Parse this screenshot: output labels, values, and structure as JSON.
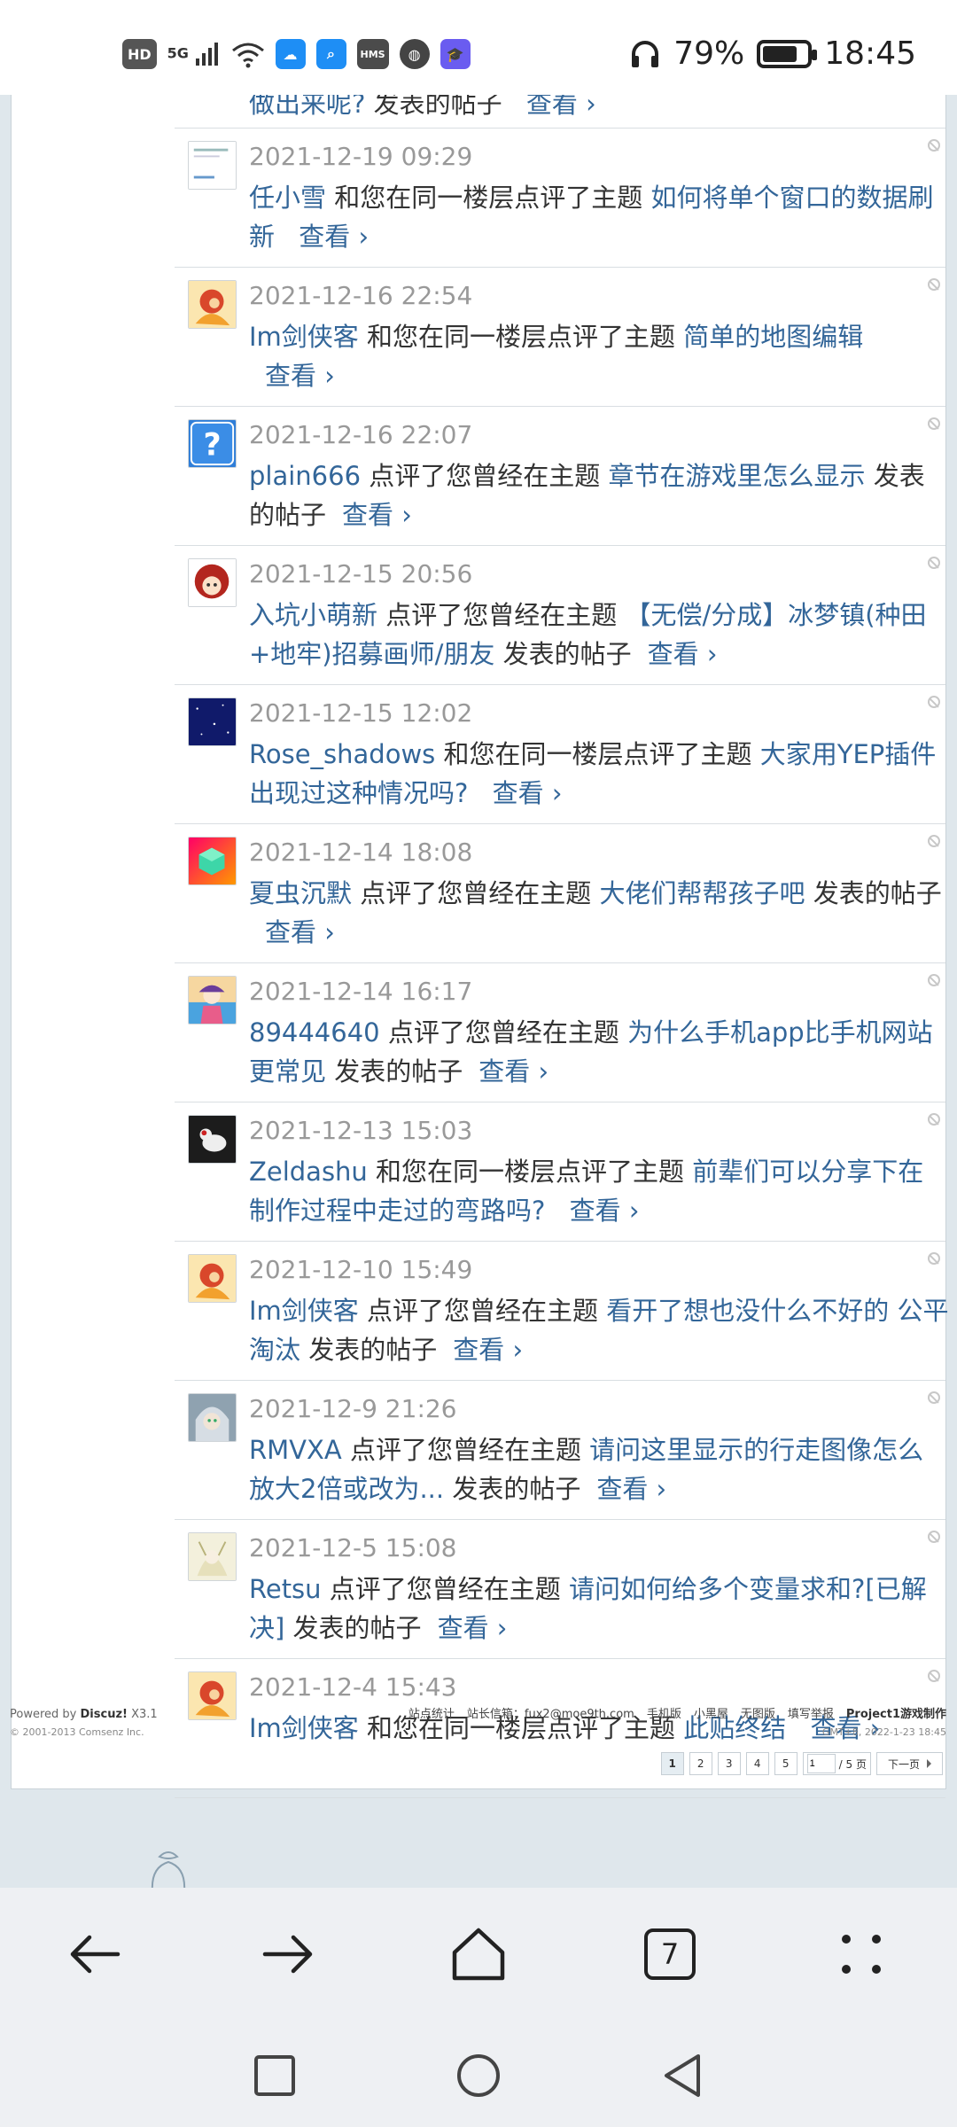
{
  "status_bar": {
    "hd": "HD",
    "net": "5G",
    "hms": "HMS",
    "battery_pct": "79%",
    "battery_level": 0.79,
    "time": "18:45"
  },
  "partial_top": {
    "text_link": "做出来呢?",
    "text_tail": "发表的帖子",
    "more": "查看 ›"
  },
  "notices": [
    {
      "date": "2021-12-19 09:29",
      "user": "任小雪",
      "action": "和您在同一楼层点评了主题",
      "topic": "如何将单个窗口的数据刷新",
      "tail": "",
      "more": "查看 ›",
      "avatar": "doc"
    },
    {
      "date": "2021-12-16 22:54",
      "user": "Im剑侠客",
      "action": "和您在同一楼层点评了主题",
      "topic": "简单的地图编辑",
      "tail": "",
      "more": "查看 ›",
      "avatar": "warrior"
    },
    {
      "date": "2021-12-16 22:07",
      "user": "plain666",
      "action": "点评了您曾经在主题",
      "topic": "章节在游戏里怎么显示",
      "tail": "发表的帖子",
      "more": "查看 ›",
      "avatar": "question"
    },
    {
      "date": "2021-12-15 20:56",
      "user": "入坑小萌新",
      "action": "点评了您曾经在主题",
      "topic": "【无偿/分成】冰梦镇(种田+地牢)招募画师/朋友",
      "tail": "发表的帖子",
      "more": "查看 ›",
      "avatar": "redgirl"
    },
    {
      "date": "2021-12-15 12:02",
      "user": "Rose_shadows",
      "action": "和您在同一楼层点评了主题",
      "topic": "大家用YEP插件出现过这种情况吗?",
      "tail": "",
      "more": "查看 ›",
      "avatar": "stars"
    },
    {
      "date": "2021-12-14 18:08",
      "user": "夏虫沉默",
      "action": "点评了您曾经在主题",
      "topic": "大佬们帮帮孩子吧",
      "tail": "发表的帖子",
      "more": "查看 ›",
      "avatar": "cube"
    },
    {
      "date": "2021-12-14 16:17",
      "user": "89444640",
      "action": "点评了您曾经在主题",
      "topic": "为什么手机app比手机网站更常见",
      "tail": "发表的帖子",
      "more": "查看 ›",
      "avatar": "anime"
    },
    {
      "date": "2021-12-13 15:03",
      "user": "Zeldashu",
      "action": "和您在同一楼层点评了主题",
      "topic": "前辈们可以分享下在制作过程中走过的弯路吗?",
      "tail": "",
      "more": "查看 ›",
      "avatar": "bird"
    },
    {
      "date": "2021-12-10 15:49",
      "user": "Im剑侠客",
      "action": "点评了您曾经在主题",
      "topic": "看开了想也没什么不好的 公平淘汰",
      "tail": "发表的帖子",
      "more": "查看 ›",
      "avatar": "warrior"
    },
    {
      "date": "2021-12-9 21:26",
      "user": "RMVXA",
      "action": "点评了您曾经在主题",
      "topic": "请问这里显示的行走图像怎么放大2倍或改为...",
      "tail": "发表的帖子",
      "more": "查看 ›",
      "avatar": "silver"
    },
    {
      "date": "2021-12-5 15:08",
      "user": "Retsu",
      "action": "点评了您曾经在主题",
      "topic": "请问如何给多个变量求和?[已解决]",
      "tail": "发表的帖子",
      "more": "查看 ›",
      "avatar": "elf"
    },
    {
      "date": "2021-12-4 15:43",
      "user": "Im剑侠客",
      "action": "和您在同一楼层点评了主题",
      "topic": "此贴终结",
      "tail": "",
      "more": "查看 ›",
      "avatar": "warrior"
    }
  ],
  "pager": {
    "pages": [
      "1",
      "2",
      "3",
      "4",
      "5"
    ],
    "input_value": "1",
    "total": "/ 5 页",
    "next": "下一页"
  },
  "footer": {
    "powered": "Powered by",
    "brand": "Discuz!",
    "version": "X3.1",
    "copyright": "© 2001-2013 Comsenz Inc.",
    "links": [
      "站点统计",
      "站长信箱：fux2@moe9th.com",
      "手机版",
      "小黑屋",
      "无图版",
      "填写举报"
    ],
    "site": "Project1游戏制作",
    "time": "GMT+8, 2022-1-23 18:45"
  },
  "browser": {
    "tab_count": "7"
  }
}
